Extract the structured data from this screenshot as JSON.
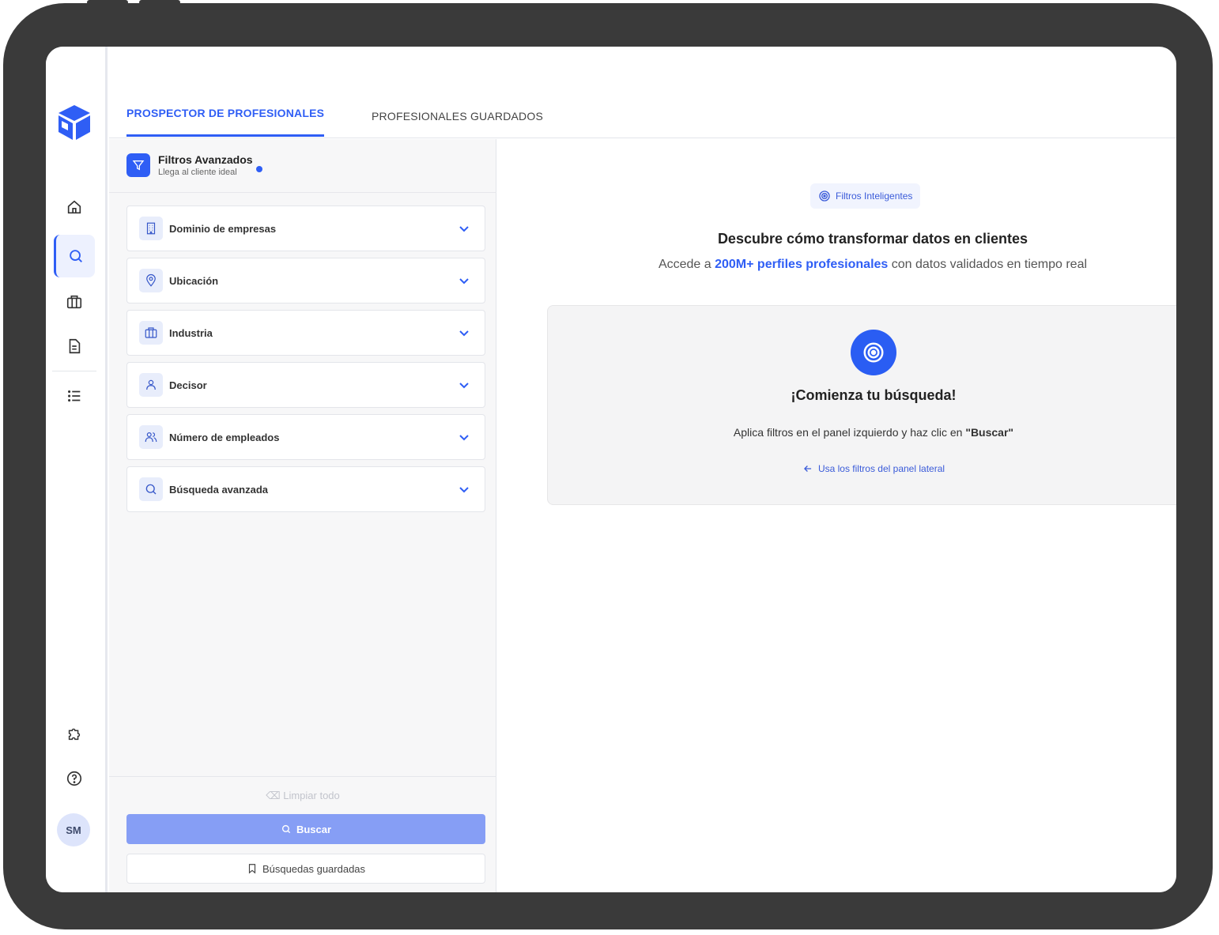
{
  "tabs": {
    "active": "PROSPECTOR DE PROFESIONALES",
    "inactive": "PROFESIONALES GUARDADOS"
  },
  "panel": {
    "title": "Filtros Avanzados",
    "subtitle": "Llega al cliente ideal",
    "filters": [
      {
        "label": "Dominio de empresas",
        "icon": "building-icon"
      },
      {
        "label": "Ubicación",
        "icon": "location-pin-icon"
      },
      {
        "label": "Industria",
        "icon": "briefcase-icon"
      },
      {
        "label": "Decisor",
        "icon": "user-icon"
      },
      {
        "label": "Número de empleados",
        "icon": "users-icon"
      },
      {
        "label": "Búsqueda avanzada",
        "icon": "search-icon"
      }
    ],
    "clear_label": "Limpiar todo",
    "search_label": "Buscar",
    "saved_label": "Búsquedas guardadas"
  },
  "main": {
    "pill_label": "Filtros Inteligentes",
    "headline": "Descubre cómo transformar datos en clientes",
    "sub_prefix": "Accede a ",
    "sub_highlight": "200M+ perfiles profesionales",
    "sub_suffix": " con datos validados en tiempo real",
    "card_title": "¡Comienza tu búsqueda!",
    "card_text": "Aplica filtros en el panel izquierdo y haz clic en ",
    "card_text_bold": "\"Buscar\"",
    "card_link": "Usa los filtros del panel lateral"
  },
  "user": {
    "initials": "SM"
  },
  "colors": {
    "accent": "#2f5ef5",
    "button_disabled": "#869ef5",
    "device": "#3a3a3a"
  }
}
